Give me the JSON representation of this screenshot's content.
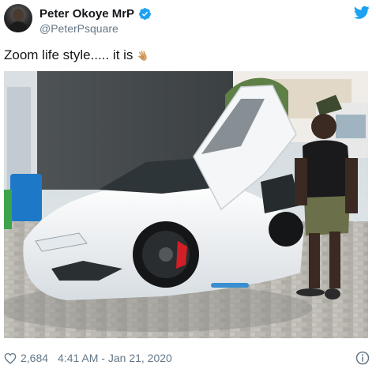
{
  "author": {
    "display_name": "Peter Okoye MrP",
    "handle": "@PeterPsquare",
    "verified": true
  },
  "tweet": {
    "text": "Zoom life style..... it is",
    "emoji": "ok-hand-emoji"
  },
  "footer": {
    "like_count": "2,684",
    "timestamp": "4:41 AM - Jan 21, 2020"
  },
  "icons": {
    "brand": "twitter-bird-icon",
    "verified": "verified-badge-icon",
    "like": "heart-icon",
    "info": "info-icon"
  },
  "colors": {
    "brand_blue": "#1da1f2",
    "text_primary": "#14171a",
    "text_secondary": "#657786"
  }
}
